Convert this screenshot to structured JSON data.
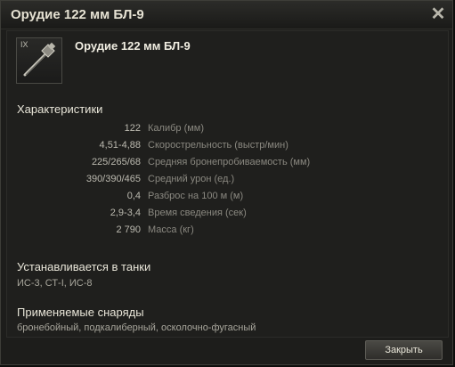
{
  "window": {
    "title": "Орудие 122 мм БЛ-9",
    "close_icon": "close-icon"
  },
  "module": {
    "tier": "IX",
    "name": "Орудие 122 мм БЛ-9",
    "icon": "gun-icon"
  },
  "characteristics": {
    "title": "Характеристики",
    "rows": [
      {
        "value": "122",
        "label": "Калибр (мм)"
      },
      {
        "value": "4,51-4,88",
        "label": "Скорострельность (выстр/мин)"
      },
      {
        "value": "225/265/68",
        "label": "Средняя бронепробиваемость (мм)"
      },
      {
        "value": "390/390/465",
        "label": "Средний урон (ед.)"
      },
      {
        "value": "0,4",
        "label": "Разброс на 100 м (м)"
      },
      {
        "value": "2,9-3,4",
        "label": "Время сведения (сек)"
      },
      {
        "value": "2 790",
        "label": "Масса (кг)"
      }
    ]
  },
  "installed_in": {
    "title": "Устанавливается в танки",
    "value": "ИС-3, СТ-I, ИС-8"
  },
  "shells": {
    "title": "Применяемые снаряды",
    "value": "бронебойный, подкалиберный, осколочно-фугасный"
  },
  "footer": {
    "close_label": "Закрыть"
  }
}
